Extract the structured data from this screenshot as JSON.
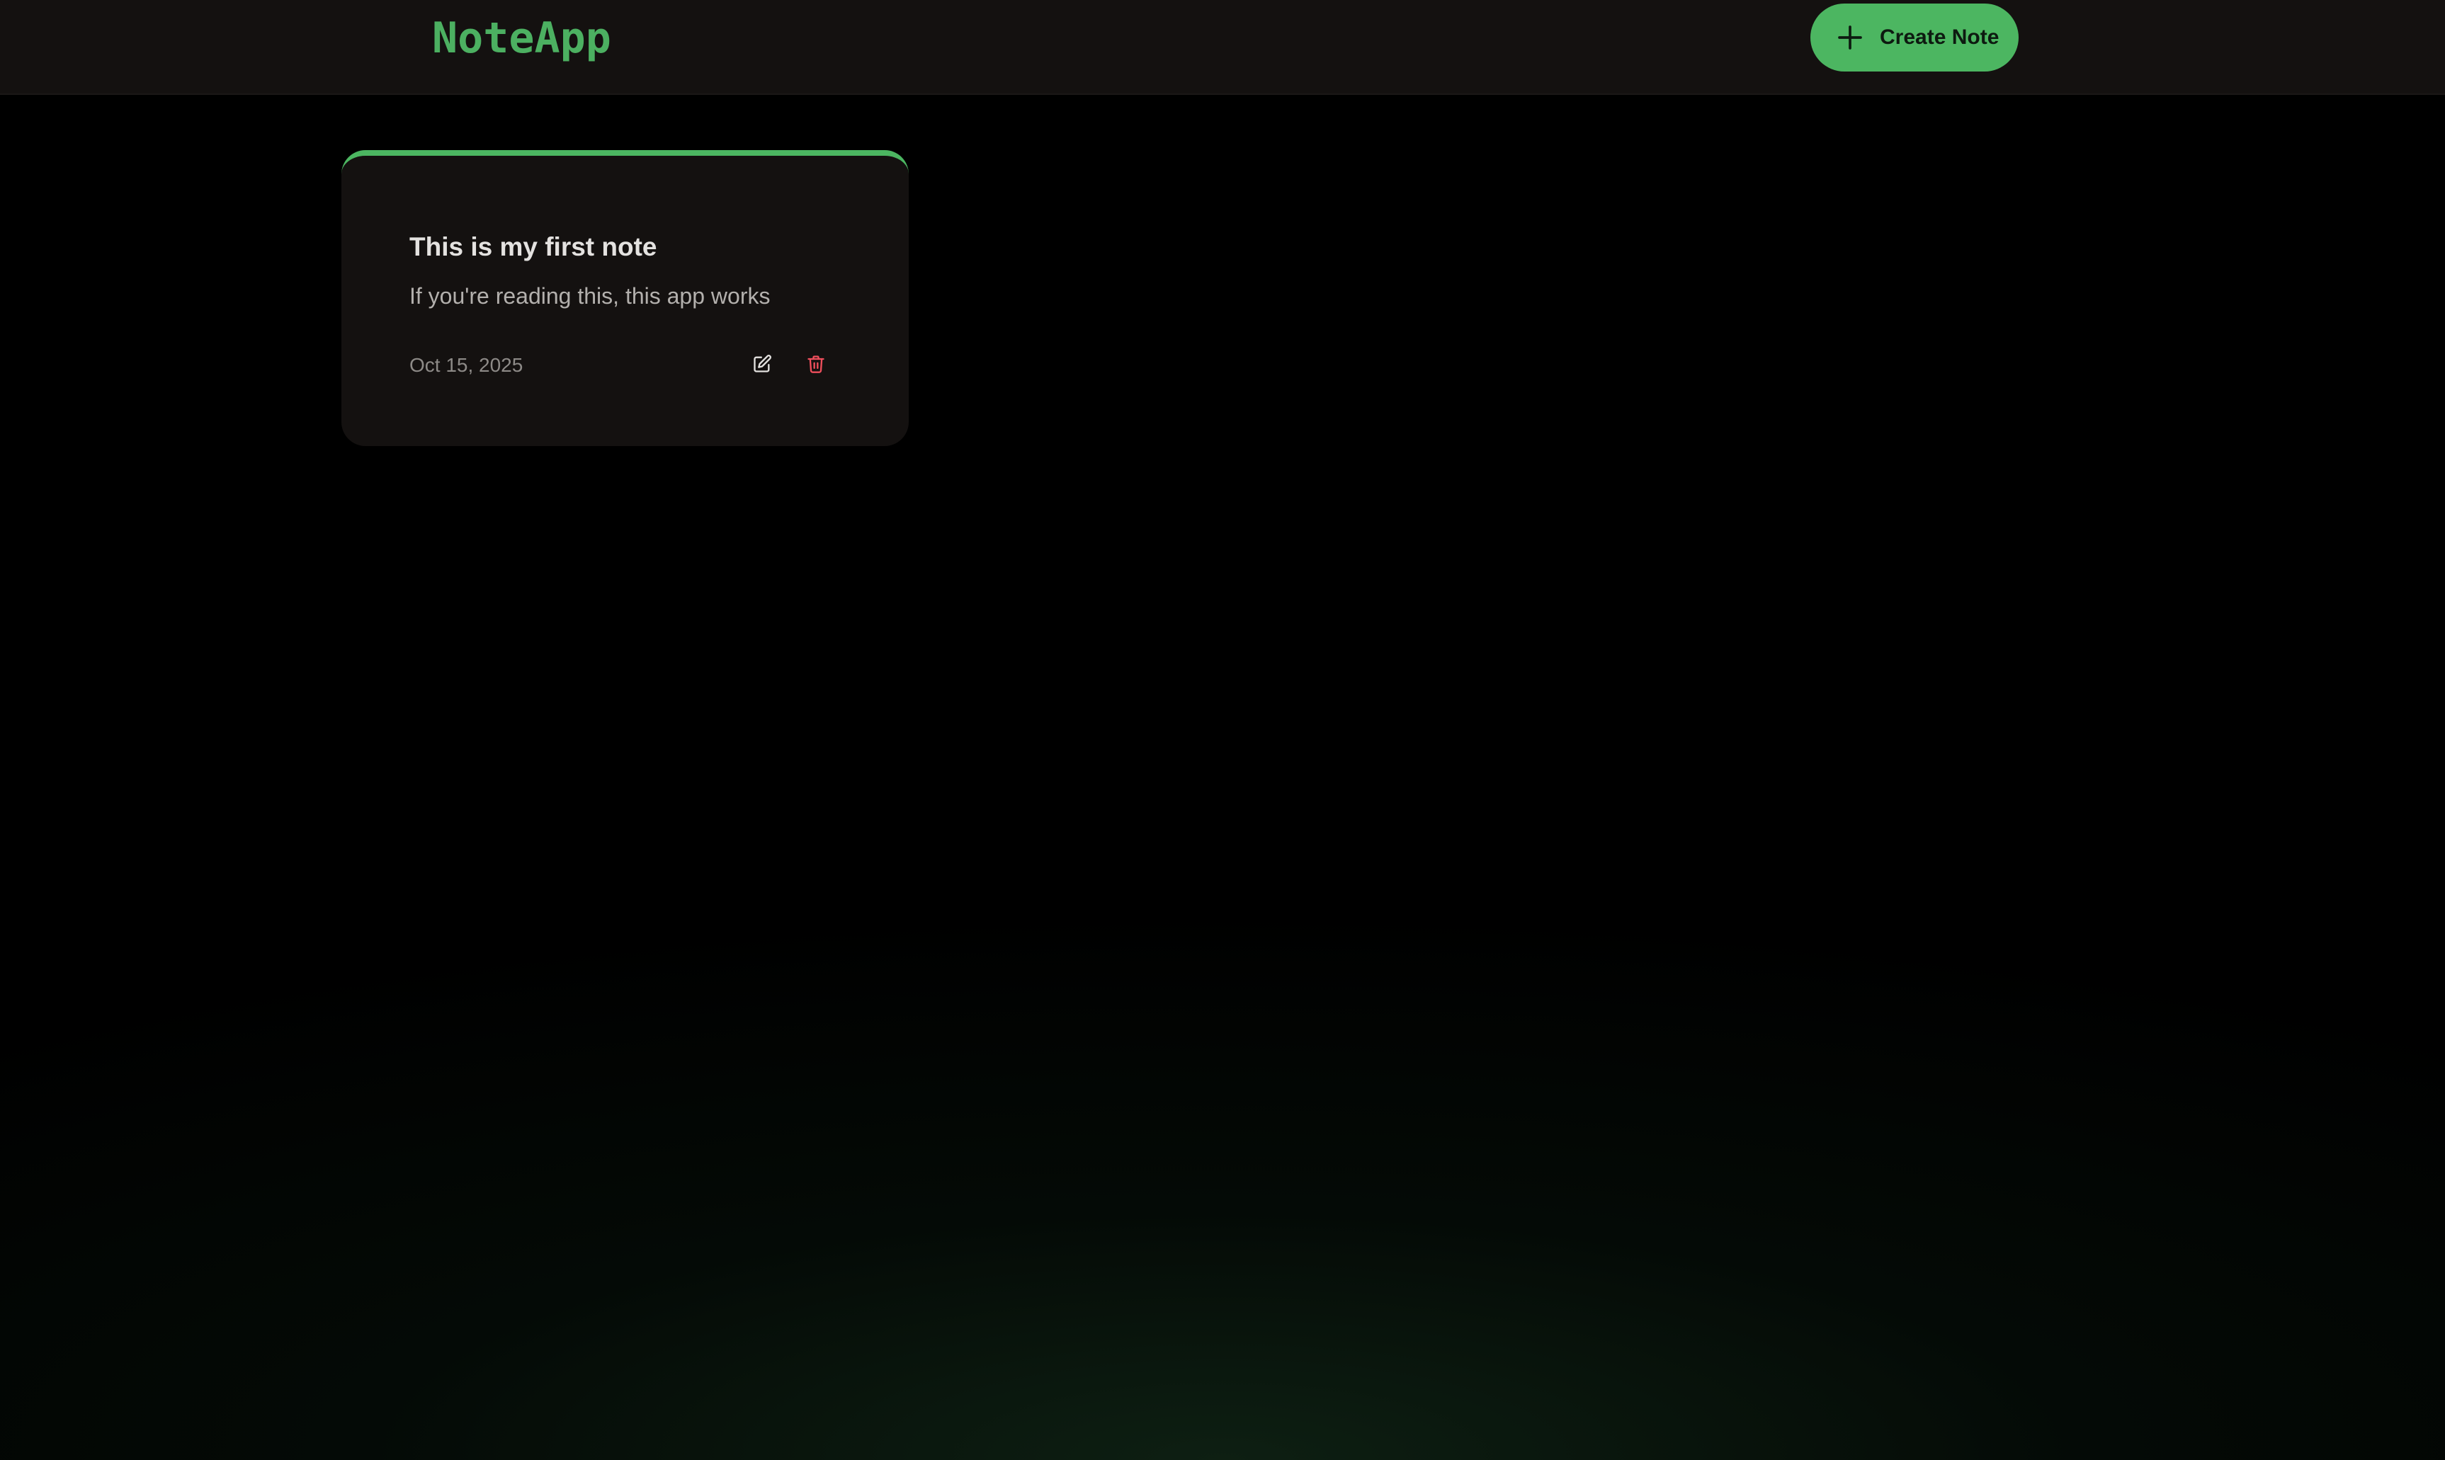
{
  "app": {
    "title": "NoteApp"
  },
  "header": {
    "create_button": {
      "label": "Create Note",
      "icon": "plus-icon"
    }
  },
  "notes": [
    {
      "title": "This is my first note",
      "body": "If you're reading this, this app works",
      "date": "Oct 15, 2025",
      "actions": [
        {
          "name": "edit",
          "icon": "edit-icon"
        },
        {
          "name": "delete",
          "icon": "trash-icon"
        }
      ]
    }
  ],
  "colors": {
    "accent": "#4cb661",
    "background": "#000000",
    "surface": "#141110",
    "danger": "#ef4f5c"
  }
}
